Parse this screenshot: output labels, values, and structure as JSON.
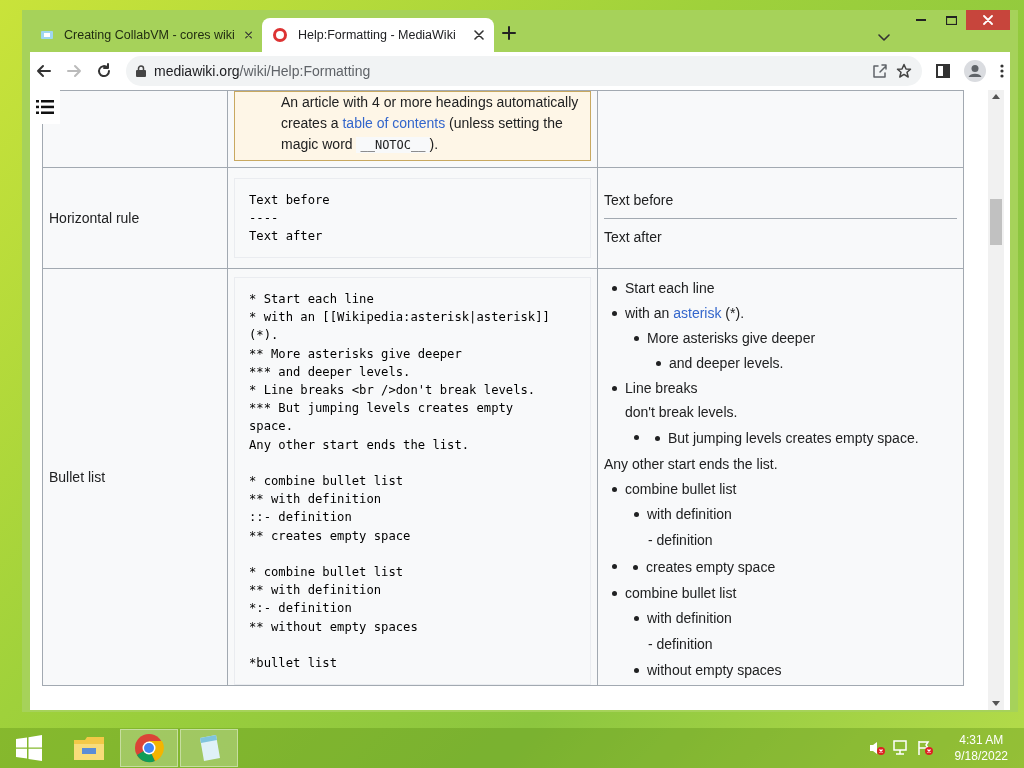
{
  "browser": {
    "tabs": [
      {
        "title": "Creating CollabVM - cores wiki",
        "selected": false
      },
      {
        "title": "Help:Formatting - MediaWiki",
        "selected": true
      }
    ],
    "url_domain": "mediawiki.org",
    "url_path": "/wiki/Help:Formatting"
  },
  "table": {
    "rows": [
      {
        "kind": "note",
        "segments": [
          {
            "kind": "text",
            "text": "An article with 4 or more headings automatically creates a "
          },
          {
            "kind": "link",
            "text": "table of contents"
          },
          {
            "kind": "text",
            "text": " (unless setting the magic word "
          },
          {
            "kind": "code",
            "text": "__NOTOC__"
          },
          {
            "kind": "text",
            "text": ")."
          }
        ]
      },
      {
        "kind": "example",
        "label": "Horizontal rule",
        "markup": "Text before\n----\nText after",
        "rendered": [
          {
            "kind": "paragraph",
            "text": "Text before"
          },
          {
            "kind": "rule"
          },
          {
            "kind": "paragraph",
            "text": "Text after"
          }
        ]
      },
      {
        "kind": "example",
        "label": "Bullet list",
        "markup": "* Start each line\n* with an [[Wikipedia:asterisk|asterisk]]\n(*).\n** More asterisks give deeper\n*** and deeper levels.\n* Line breaks <br />don't break levels.\n*** But jumping levels creates empty\nspace.\nAny other start ends the list.\n\n* combine bullet list\n** with definition\n::- definition\n** creates empty space\n\n* combine bullet list\n** with definition\n*:- definition\n** without empty spaces\n\n*bullet list",
        "rendered": [
          {
            "kind": "list",
            "items": [
              {
                "kind": "text",
                "lines": [
                  "Start each line"
                ]
              },
              {
                "kind": "link",
                "text": "with an ",
                "link": "asterisk",
                "text_after": " (*).",
                "children": [
                  {
                    "kind": "text",
                    "lines": [
                      "More asterisks give deeper"
                    ],
                    "children": [
                      {
                        "kind": "text",
                        "lines": [
                          "and deeper levels."
                        ]
                      }
                    ]
                  }
                ]
              },
              {
                "kind": "text",
                "lines": [
                  "Line breaks",
                  "don't break levels."
                ],
                "children": [
                  {
                    "kind": "empty",
                    "children": [
                      {
                        "kind": "text",
                        "lines": [
                          "But jumping levels creates empty space."
                        ]
                      }
                    ]
                  }
                ]
              }
            ]
          },
          {
            "kind": "paragraph",
            "text": "Any other start ends the list."
          },
          {
            "kind": "list",
            "items": [
              {
                "kind": "text",
                "lines": [
                  "combine bullet list"
                ],
                "children": [
                  {
                    "kind": "text",
                    "lines": [
                      "with definition"
                    ],
                    "definition": "- definition"
                  }
                ]
              },
              {
                "kind": "empty",
                "children": [
                  {
                    "kind": "text",
                    "lines": [
                      "creates empty space"
                    ]
                  }
                ]
              },
              {
                "kind": "text",
                "lines": [
                  "combine bullet list"
                ],
                "children": [
                  {
                    "kind": "text",
                    "lines": [
                      "with definition"
                    ],
                    "definition": "- definition"
                  },
                  {
                    "kind": "text",
                    "lines": [
                      "without empty spaces"
                    ]
                  }
                ]
              }
            ]
          }
        ]
      }
    ]
  },
  "taskbar": {
    "time": "4:31 AM",
    "date": "9/18/2022"
  }
}
